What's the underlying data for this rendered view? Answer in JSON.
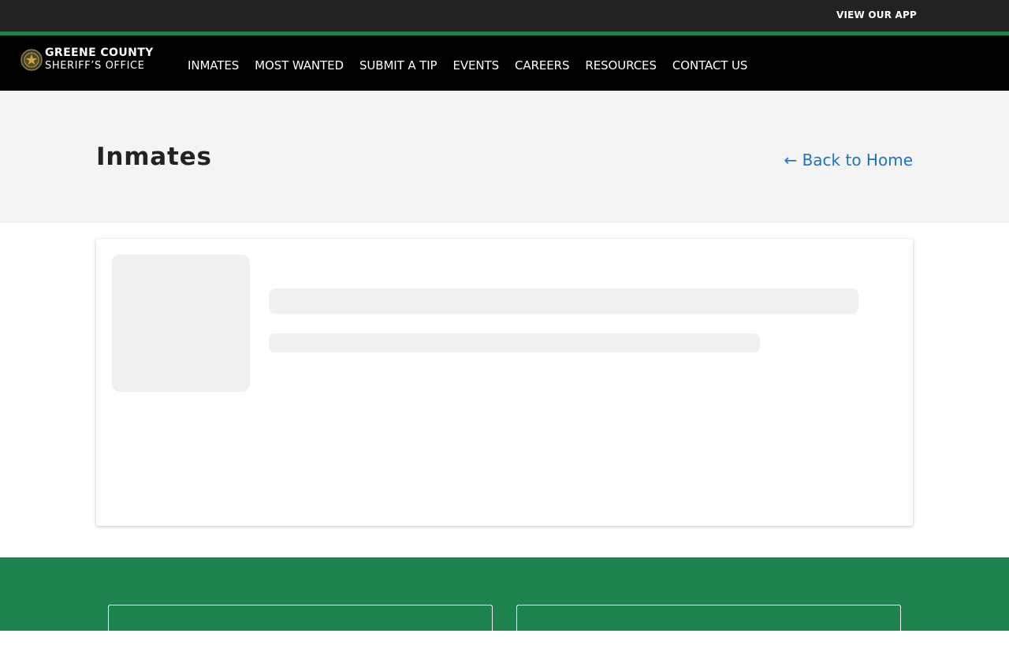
{
  "topbar": {
    "app_link": "VIEW OUR APP"
  },
  "colors": {
    "accent": "#1e844d",
    "link": "#1a73c8",
    "topbar": "#222222",
    "navbar": "#000000"
  },
  "logo": {
    "line1": "GREENE COUNTY",
    "line2": "SHERIFF’S OFFICE",
    "icon": "sheriff-badge-icon"
  },
  "nav": {
    "items": [
      {
        "label": "INMATES"
      },
      {
        "label": "MOST WANTED"
      },
      {
        "label": "SUBMIT A TIP"
      },
      {
        "label": "EVENTS"
      },
      {
        "label": "CAREERS"
      },
      {
        "label": "RESOURCES"
      },
      {
        "label": "CONTACT US"
      }
    ]
  },
  "hero": {
    "title": "Inmates",
    "back_link": "← Back to Home"
  }
}
